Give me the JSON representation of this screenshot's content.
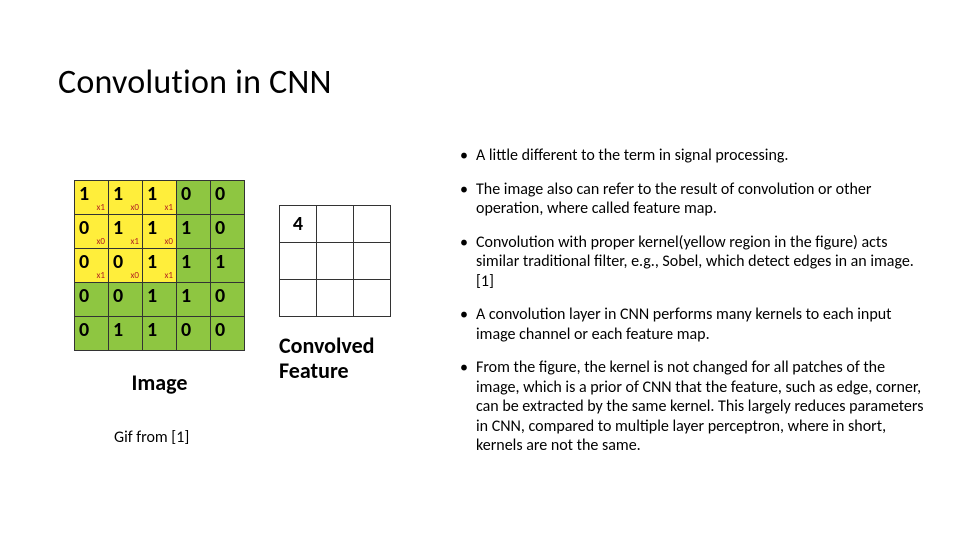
{
  "title": "Convolution in CNN",
  "image_matrix": {
    "rows": [
      [
        {
          "v": "1",
          "k": "x1",
          "y": true
        },
        {
          "v": "1",
          "k": "x0",
          "y": true
        },
        {
          "v": "1",
          "k": "x1",
          "y": true
        },
        {
          "v": "0"
        },
        {
          "v": "0"
        }
      ],
      [
        {
          "v": "0",
          "k": "x0",
          "y": true
        },
        {
          "v": "1",
          "k": "x1",
          "y": true
        },
        {
          "v": "1",
          "k": "x0",
          "y": true
        },
        {
          "v": "1"
        },
        {
          "v": "0"
        }
      ],
      [
        {
          "v": "0",
          "k": "x1",
          "y": true
        },
        {
          "v": "0",
          "k": "x0",
          "y": true
        },
        {
          "v": "1",
          "k": "x1",
          "y": true
        },
        {
          "v": "1"
        },
        {
          "v": "1"
        }
      ],
      [
        {
          "v": "0"
        },
        {
          "v": "0"
        },
        {
          "v": "1"
        },
        {
          "v": "1"
        },
        {
          "v": "0"
        }
      ],
      [
        {
          "v": "0"
        },
        {
          "v": "1"
        },
        {
          "v": "1"
        },
        {
          "v": "0"
        },
        {
          "v": "0"
        }
      ]
    ],
    "label": "Image"
  },
  "convolved": {
    "grid": [
      [
        "4",
        "",
        ""
      ],
      [
        "",
        "",
        ""
      ],
      [
        "",
        "",
        ""
      ]
    ],
    "label_line1": "Convolved",
    "label_line2": "Feature"
  },
  "gif_caption": "Gif from [1]",
  "bullets": [
    "A little different to the term in signal processing.",
    "The image also can refer to the result of convolution or other operation, where called feature map.",
    "Convolution with proper kernel(yellow region in the figure) acts similar traditional filter, e.g., Sobel, which detect edges in an image.[1]",
    "A convolution layer in CNN performs many kernels to each input image channel or each feature map.",
    "From the figure, the kernel is not changed for all patches of the image, which is a prior of CNN that the feature, such as edge, corner, can be extracted by the same kernel. This largely reduces parameters in CNN, compared  to  multiple layer perceptron, where in short, kernels are not the same."
  ]
}
